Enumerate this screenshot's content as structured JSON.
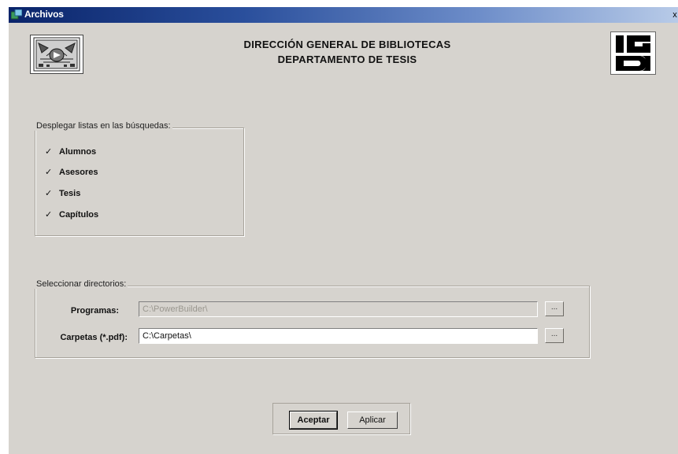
{
  "window": {
    "title": "Archivos",
    "close_glyph": "x"
  },
  "header": {
    "line1": "DIRECCIÓN GENERAL DE BIBLIOTECAS",
    "line2": "DEPARTAMENTO DE TESIS"
  },
  "logos": {
    "left": "unam-seal-logo",
    "right": "dgb-logo"
  },
  "search_lists": {
    "legend": "Desplegar listas en las búsquedas:",
    "items": [
      {
        "label": "Alumnos",
        "checked": true
      },
      {
        "label": "Asesores",
        "checked": true
      },
      {
        "label": "Tesis",
        "checked": true
      },
      {
        "label": "Capítulos",
        "checked": true
      }
    ]
  },
  "directories": {
    "legend": "Seleccionar directorios:",
    "programas": {
      "label": "Programas:",
      "value": "C:\\PowerBuilder\\",
      "enabled": false,
      "browse_label": "..."
    },
    "carpetas": {
      "label": "Carpetas (*.pdf):",
      "value": "C:\\Carpetas\\",
      "enabled": true,
      "browse_label": "..."
    }
  },
  "buttons": {
    "accept": "Aceptar",
    "apply": "Aplicar"
  },
  "colors": {
    "titlebar_start": "#0a246a",
    "titlebar_end": "#b8cbe8",
    "dialog_bg": "#d6d3ce"
  }
}
